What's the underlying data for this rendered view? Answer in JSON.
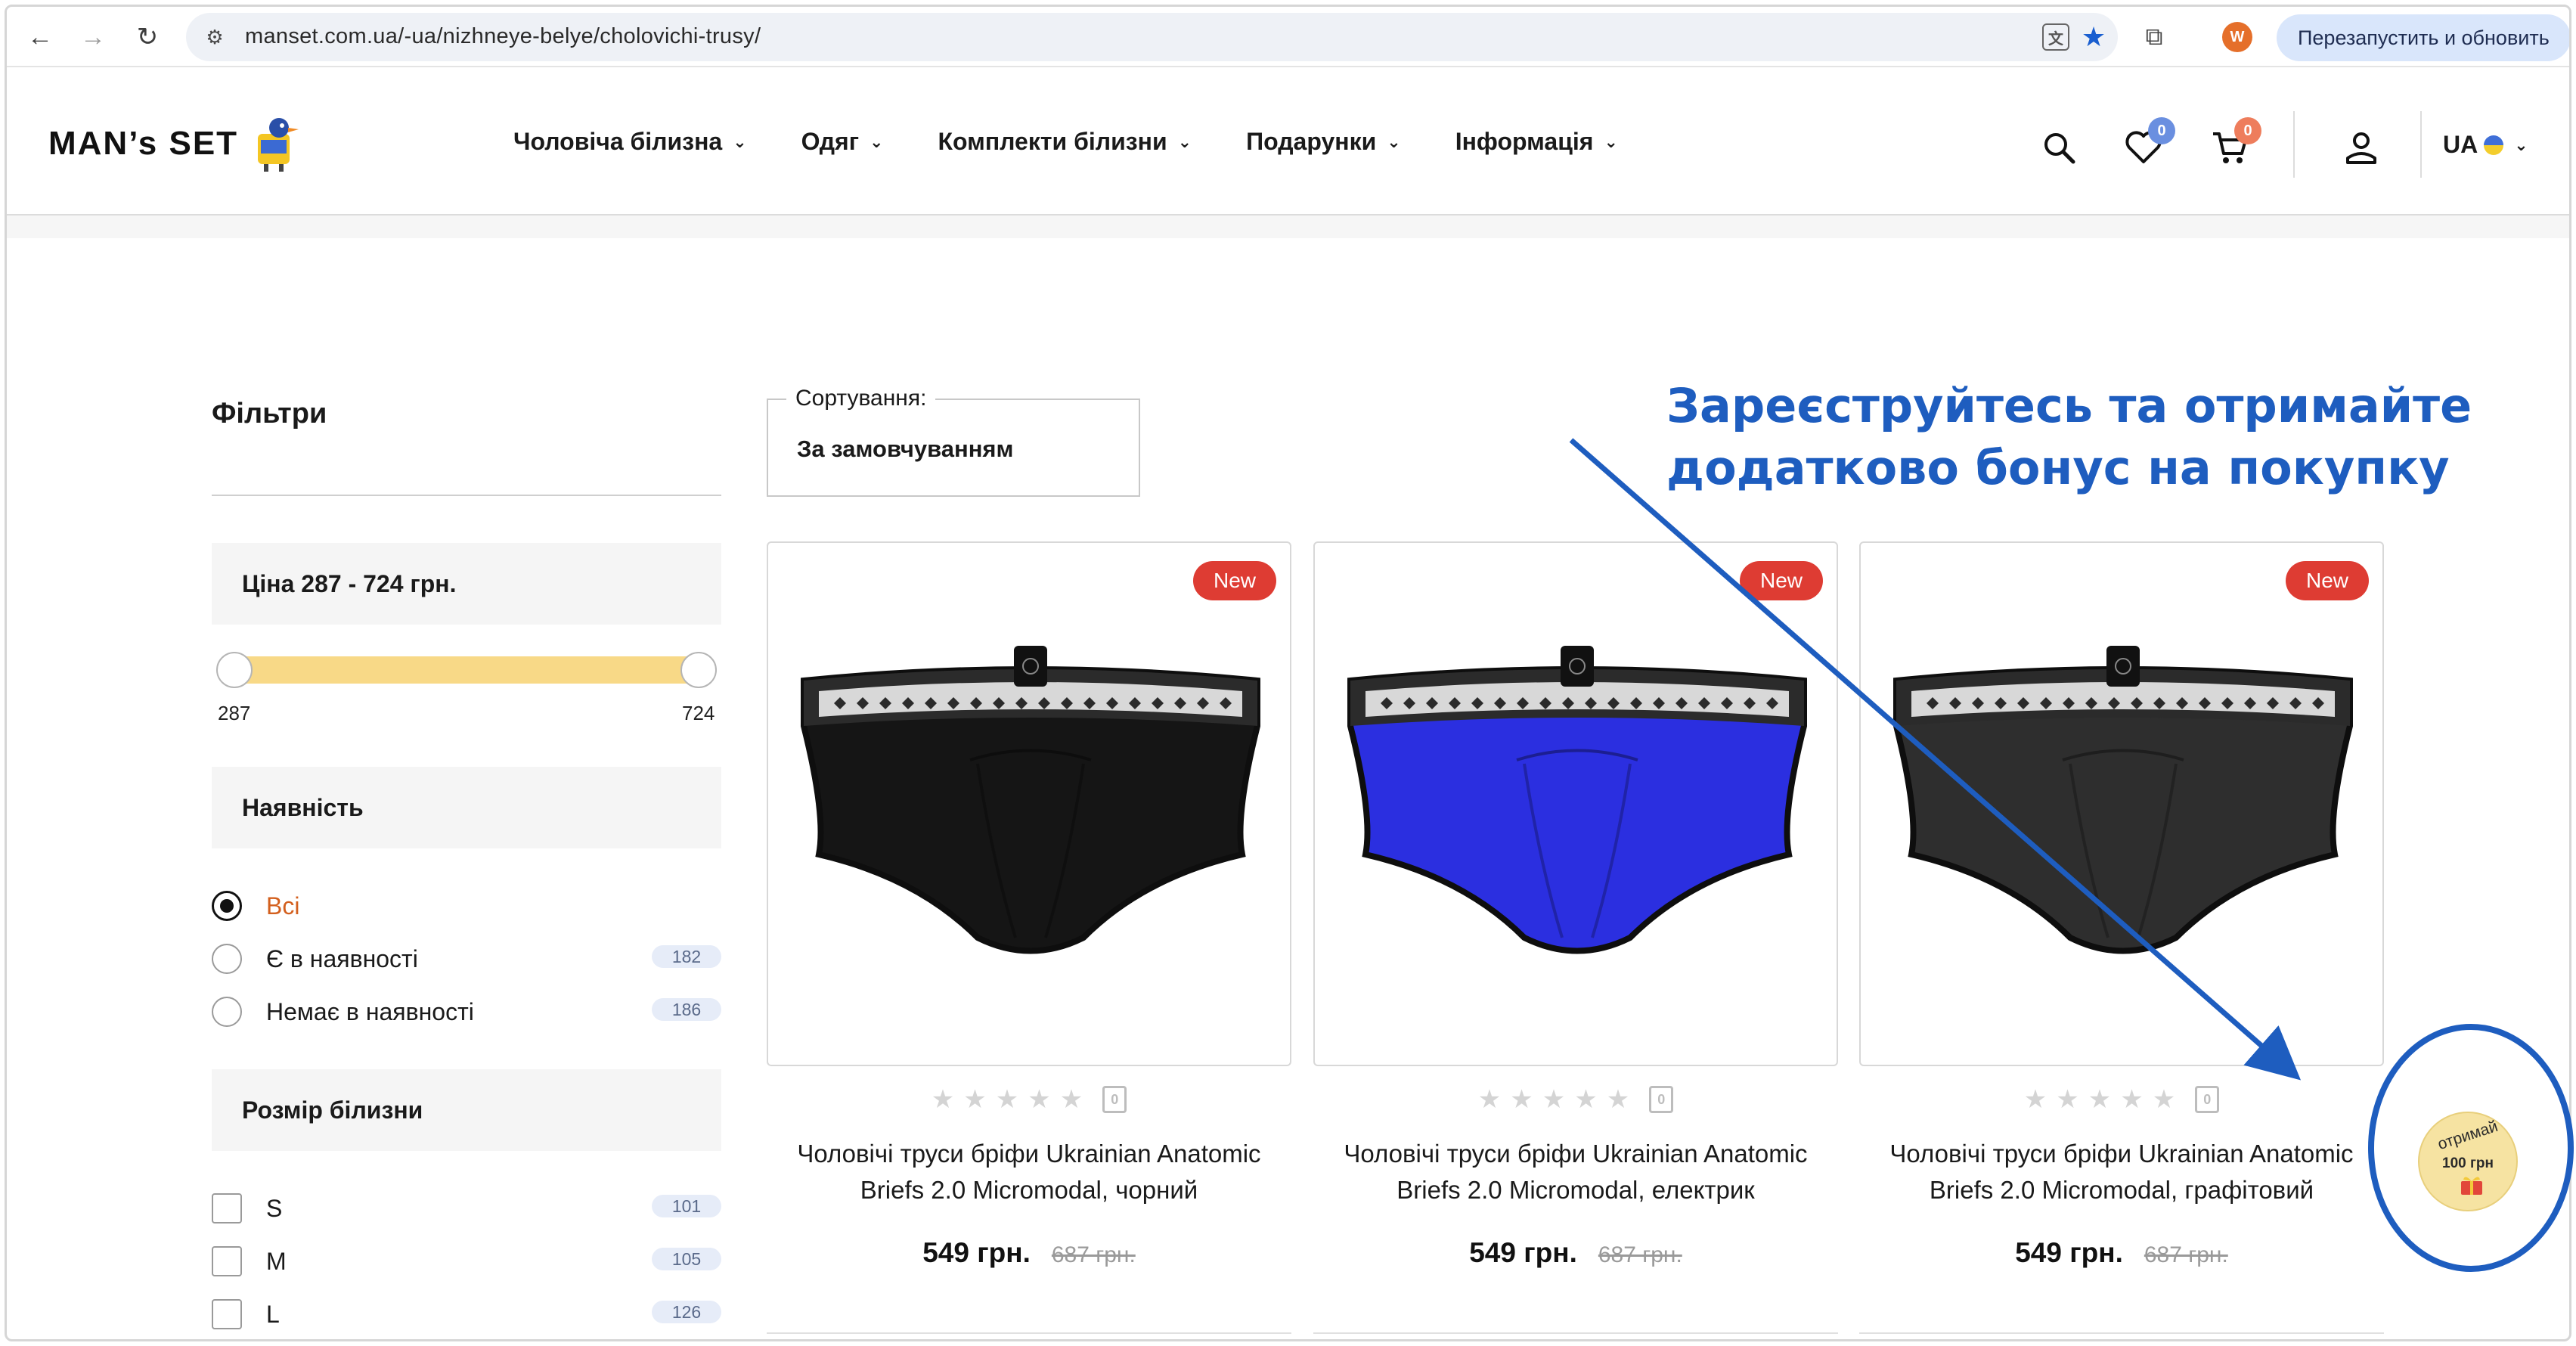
{
  "browser": {
    "url": "manset.com.ua/-ua/nizhneye-belye/cholovichi-trusy/",
    "profile_initial": "W",
    "relaunch_label": "Перезапустить и обновить"
  },
  "header": {
    "logo": "MAN’s SET",
    "nav": [
      {
        "label": "Чоловіча білизна"
      },
      {
        "label": "Одяг"
      },
      {
        "label": "Комплекти білизни"
      },
      {
        "label": "Подарунки"
      },
      {
        "label": "Інформація"
      }
    ],
    "wishlist_count": "0",
    "cart_count": "0",
    "language": "UA"
  },
  "filters": {
    "title": "Фільтри",
    "price_label": "Ціна  287 - 724 грн.",
    "price_min": "287",
    "price_max": "724",
    "availability_title": "Наявність",
    "availability": [
      {
        "label": "Всі",
        "count": ""
      },
      {
        "label": "Є в наявності",
        "count": "182"
      },
      {
        "label": "Немає в наявності",
        "count": "186"
      }
    ],
    "size_title": "Розмір білизни",
    "sizes": [
      {
        "label": "S",
        "count": "101"
      },
      {
        "label": "M",
        "count": "105"
      },
      {
        "label": "L",
        "count": "126"
      }
    ]
  },
  "sort": {
    "label": "Сортування:",
    "value": "За замовчуванням"
  },
  "products": [
    {
      "badge": "New",
      "name_line1": "Чоловічі труси бріфи Ukrainian Anatomic",
      "name_line2": "Briefs 2.0 Micromodal, чорний",
      "price": "549 грн.",
      "old_price": "687 грн.",
      "color": "#151515"
    },
    {
      "badge": "New",
      "name_line1": "Чоловічі труси бріфи Ukrainian Anatomic",
      "name_line2": "Briefs 2.0 Micromodal, електрик",
      "price": "549 грн.",
      "old_price": "687 грн.",
      "color": "#2b2fe0"
    },
    {
      "badge": "New",
      "name_line1": "Чоловічі труси бріфи Ukrainian Anatomic",
      "name_line2": "Briefs 2.0 Micromodal, графітовий",
      "price": "549 грн.",
      "old_price": "687 грн.",
      "color": "#2e2e2e"
    }
  ],
  "promo": {
    "line1": "Зареєструйтесь та отримайте",
    "line2": "додатково бонус на покупку",
    "badge_top": "отримай",
    "badge_amount": "100 грн",
    "accent": "#1e5dbf"
  }
}
